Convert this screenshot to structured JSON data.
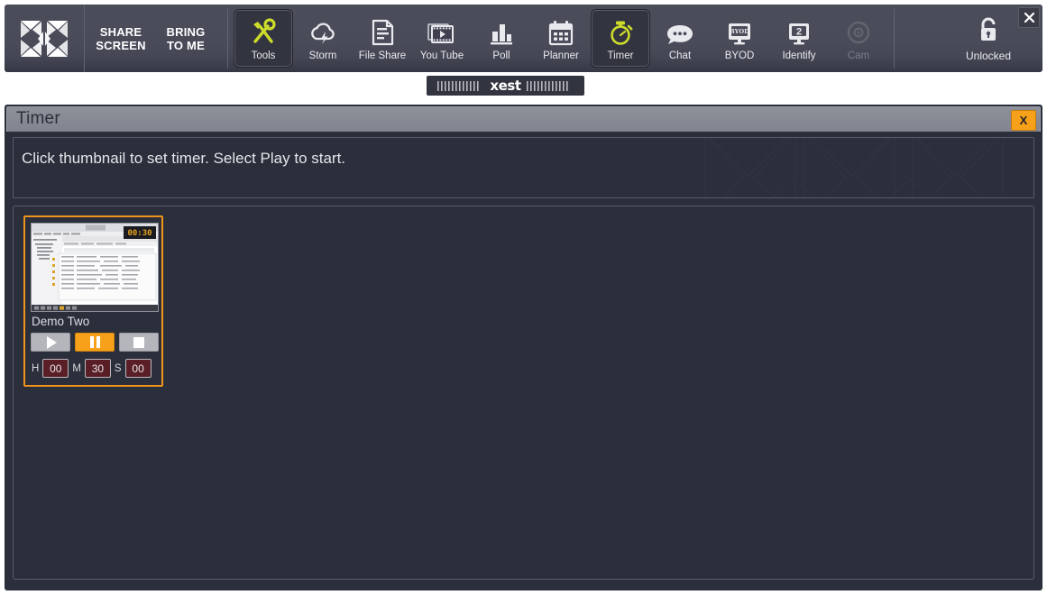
{
  "window": {
    "close_label": "✕",
    "close_icon": "close-icon"
  },
  "toolbar": {
    "logo_icon": "xest-x-logo",
    "share_screen": {
      "line1": "SHARE",
      "line2": "SCREEN"
    },
    "bring_to_me": {
      "line1": "BRING",
      "line2": "TO ME"
    },
    "items": [
      {
        "label": "Tools",
        "icon": "tools-icon",
        "state": "active"
      },
      {
        "label": "Storm",
        "icon": "storm-cloud-icon",
        "state": "normal"
      },
      {
        "label": "File Share",
        "icon": "file-share-icon",
        "state": "normal"
      },
      {
        "label": "You Tube",
        "icon": "youtube-icon",
        "state": "normal"
      },
      {
        "label": "Poll",
        "icon": "poll-bars-icon",
        "state": "normal"
      },
      {
        "label": "Planner",
        "icon": "calendar-icon",
        "state": "normal"
      },
      {
        "label": "Timer",
        "icon": "stopwatch-icon",
        "state": "active"
      },
      {
        "label": "Chat",
        "icon": "chat-bubble-icon",
        "state": "normal"
      },
      {
        "label": "BYOD",
        "icon": "byod-monitor-icon",
        "state": "normal"
      },
      {
        "label": "Identify",
        "icon": "identify-monitor-icon",
        "state": "normal",
        "badge": "2"
      },
      {
        "label": "Cam",
        "icon": "camera-icon",
        "state": "disabled"
      }
    ],
    "lock": {
      "label": "Unlocked",
      "icon": "padlock-open-icon"
    }
  },
  "brand_strip": {
    "text": "xest"
  },
  "panel": {
    "title": "Timer",
    "close_label": "X",
    "instruction": "Click thumbnail to set timer. Select Play to start."
  },
  "timer_cards": [
    {
      "name": "Demo Two",
      "thumbnail_icon": "screenshot-thumbnail",
      "controls": [
        {
          "name": "play",
          "icon": "play-icon",
          "active": false
        },
        {
          "name": "pause",
          "icon": "pause-icon",
          "active": true
        },
        {
          "name": "stop",
          "icon": "stop-icon",
          "active": false
        }
      ],
      "time": {
        "hours_label": "H",
        "hours": "00",
        "minutes_label": "M",
        "minutes": "30",
        "seconds_label": "S",
        "seconds": "00"
      }
    }
  ],
  "colors": {
    "accent_orange": "#f7a11a",
    "accent_yellow_green": "#cddc2a",
    "panel_bg": "#2b2e3b",
    "toolbar_bg": "#494b59",
    "field_maroon": "#5a1f26"
  }
}
